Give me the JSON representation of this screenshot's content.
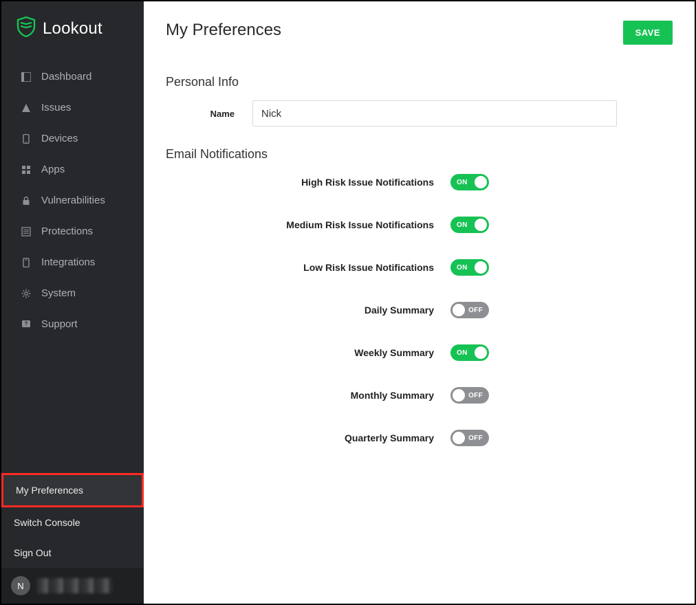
{
  "brand": "Lookout",
  "header": {
    "title": "My Preferences",
    "save_label": "SAVE"
  },
  "sidebar": {
    "items": [
      {
        "label": "Dashboard"
      },
      {
        "label": "Issues"
      },
      {
        "label": "Devices"
      },
      {
        "label": "Apps"
      },
      {
        "label": "Vulnerabilities"
      },
      {
        "label": "Protections"
      },
      {
        "label": "Integrations"
      },
      {
        "label": "System"
      },
      {
        "label": "Support"
      }
    ],
    "bottom": [
      {
        "label": "My Preferences"
      },
      {
        "label": "Switch Console"
      },
      {
        "label": "Sign Out"
      }
    ],
    "avatar_initial": "N"
  },
  "sections": {
    "personal_info_title": "Personal Info",
    "name_label": "Name",
    "name_value": "Nick",
    "email_notifications_title": "Email Notifications"
  },
  "toggles": {
    "on_label": "ON",
    "off_label": "OFF",
    "items": [
      {
        "label": "High Risk Issue Notifications",
        "state": "on"
      },
      {
        "label": "Medium Risk Issue Notifications",
        "state": "on"
      },
      {
        "label": "Low Risk Issue Notifications",
        "state": "on"
      },
      {
        "label": "Daily Summary",
        "state": "off"
      },
      {
        "label": "Weekly Summary",
        "state": "on"
      },
      {
        "label": "Monthly Summary",
        "state": "off"
      },
      {
        "label": "Quarterly Summary",
        "state": "off"
      }
    ]
  }
}
